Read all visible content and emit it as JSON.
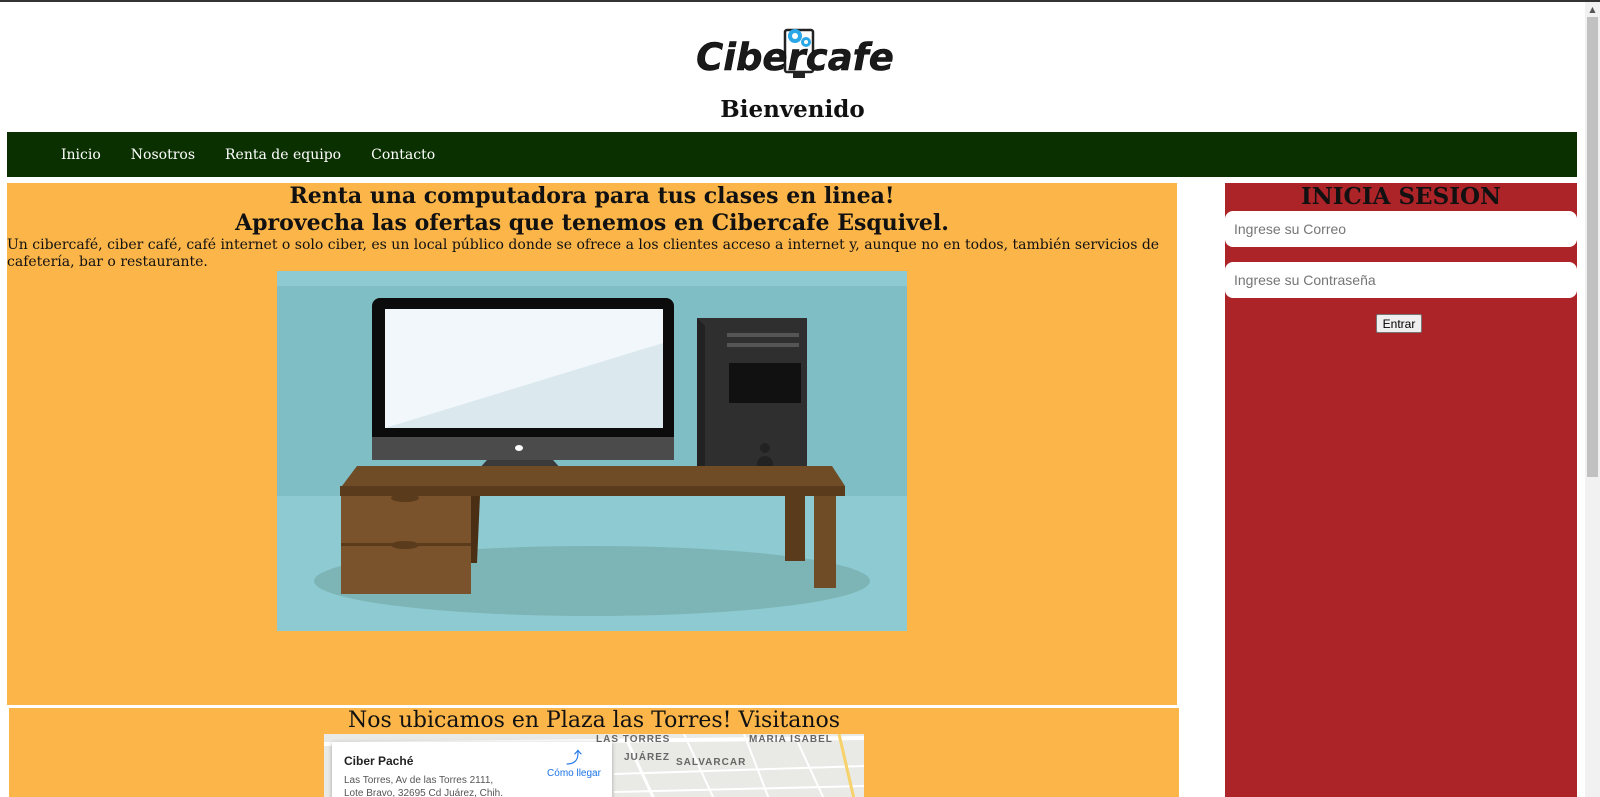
{
  "header": {
    "logo_text": "Cibercafe",
    "welcome": "Bienvenido"
  },
  "nav": {
    "items": [
      "Inicio",
      "Nosotros",
      "Renta de equipo",
      "Contacto"
    ]
  },
  "main": {
    "headline_1": "Renta una computadora para tus clases en linea!",
    "headline_2": "Aprovecha las ofertas que tenemos en Cibercafe Esquivel.",
    "description": "Un cibercafé, ciber café, café internet o solo ciber, es un local público donde se ofrece a los clientes acceso a internet y, aunque no en todos, también servicios de cafetería, bar o restaurante."
  },
  "location": {
    "title": "Nos ubicamos en Plaza las Torres! Visitanos",
    "map": {
      "place_name": "Ciber Paché",
      "address": "Las Torres, Av de las Torres 2111, Lote Bravo, 32695 Cd Juárez, Chih.",
      "directions_label": "Cómo llegar",
      "labels": [
        "LAS TORRES",
        "MARIA ISABEL",
        "JUÁREZ",
        "SALVARCAR"
      ]
    }
  },
  "login": {
    "title": "INICIA SESION",
    "email_placeholder": "Ingrese su Correo",
    "password_placeholder": "Ingrese su Contraseña",
    "submit_label": "Entrar"
  },
  "colors": {
    "nav_bg": "#0a3000",
    "main_bg": "#fbb549",
    "login_bg": "#ac2328",
    "teal_bg": "#8ecad1"
  }
}
